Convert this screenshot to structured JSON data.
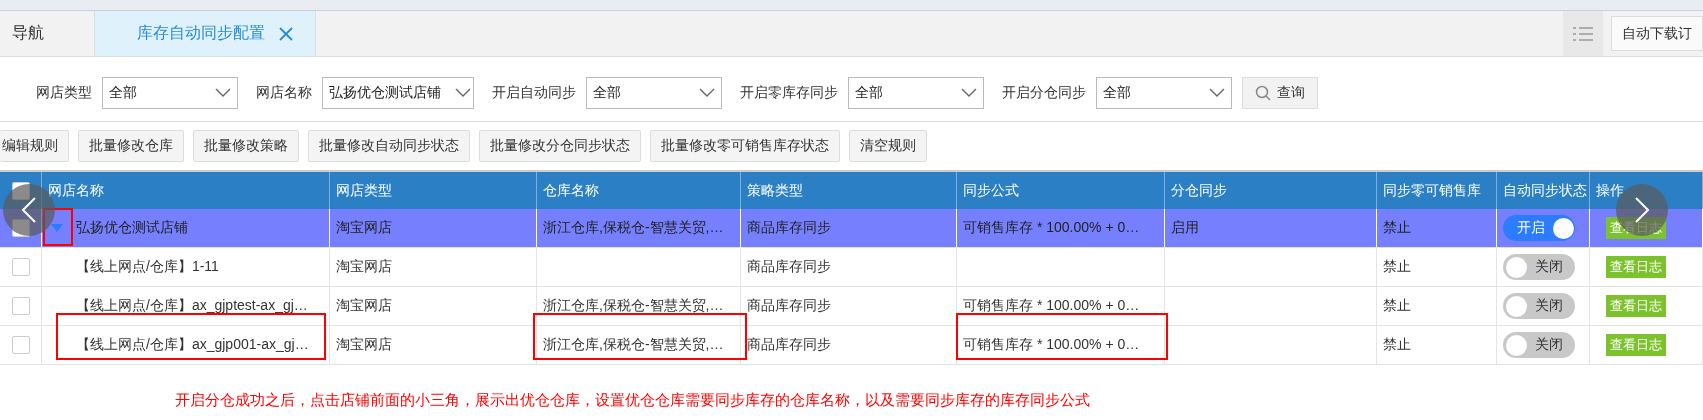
{
  "tabs": [
    {
      "label": "导航",
      "selected": false,
      "closable": false
    },
    {
      "label": "库存自动同步配置",
      "selected": true,
      "closable": true
    }
  ],
  "right_button": "自动下载订",
  "filters": [
    {
      "label": "网店类型",
      "value": "全部"
    },
    {
      "label": "网店名称",
      "value": "弘扬优仓测试店铺"
    },
    {
      "label": "开启自动同步",
      "value": "全部"
    },
    {
      "label": "开启零库存同步",
      "value": "全部"
    },
    {
      "label": "开启分仓同步",
      "value": "全部"
    }
  ],
  "search_button": "查询",
  "toolbar": [
    "编辑规则",
    "批量修改仓库",
    "批量修改策略",
    "批量修改自动同步状态",
    "批量修改分仓同步状态",
    "批量修改零可销售库存状态",
    "清空规则"
  ],
  "table": {
    "header_checked": false,
    "columns": [
      "网店名称",
      "网店类型",
      "仓库名称",
      "策略类型",
      "同步公式",
      "分仓同步",
      "同步零可销售库",
      "自动同步状态",
      "操作"
    ],
    "rows": [
      {
        "shop": "弘扬优仓测试店铺",
        "shop_type": "淘宝网店",
        "warehouse": "浙江仓库,保税仓-智慧关贸,…",
        "strategy": "商品库存同步",
        "formula": "可销售库存 * 100.00% + 0…",
        "split_sync": "启用",
        "zero_sync": "禁止",
        "auto_sync": {
          "on": true,
          "label": "开启"
        },
        "action": "查看日志",
        "selected": true,
        "expanded": true,
        "children": [
          {
            "shop": "【线上网点/仓库】1-11",
            "shop_type": "淘宝网店",
            "strategy": "商品库存同步",
            "zero_sync": "禁止",
            "auto_sync": {
              "on": false,
              "label": "关闭"
            },
            "action": "查看日志",
            "selected": false,
            "checked": false
          },
          {
            "shop": "【线上网点/仓库】ax_gjptest-ax_gj…",
            "shop_type": "淘宝网店",
            "warehouse": "浙江仓库,保税仓-智慧关贸,…",
            "strategy": "商品库存同步",
            "formula": "可销售库存 * 100.00% + 0…",
            "zero_sync": "禁止",
            "auto_sync": {
              "on": false,
              "label": "关闭"
            },
            "action": "查看日志",
            "selected": false,
            "checked": false
          },
          {
            "shop": "【线上网点/仓库】ax_gjp001-ax_gj…",
            "shop_type": "淘宝网店",
            "warehouse": "浙江仓库,保税仓-智慧关贸,…",
            "strategy": "商品库存同步",
            "formula": "可销售库存 * 100.00% + 0…",
            "zero_sync": "禁止",
            "auto_sync": {
              "on": false,
              "label": "关闭"
            },
            "action": "查看日志",
            "selected": false,
            "checked": false
          }
        ]
      }
    ]
  },
  "annotation": "开启分仓成功之后，点击店铺前面的小三角，展示出优仓仓库，设置优仓仓库需要同步库存的仓库名称，以及需要同步库存的库存同步公式"
}
